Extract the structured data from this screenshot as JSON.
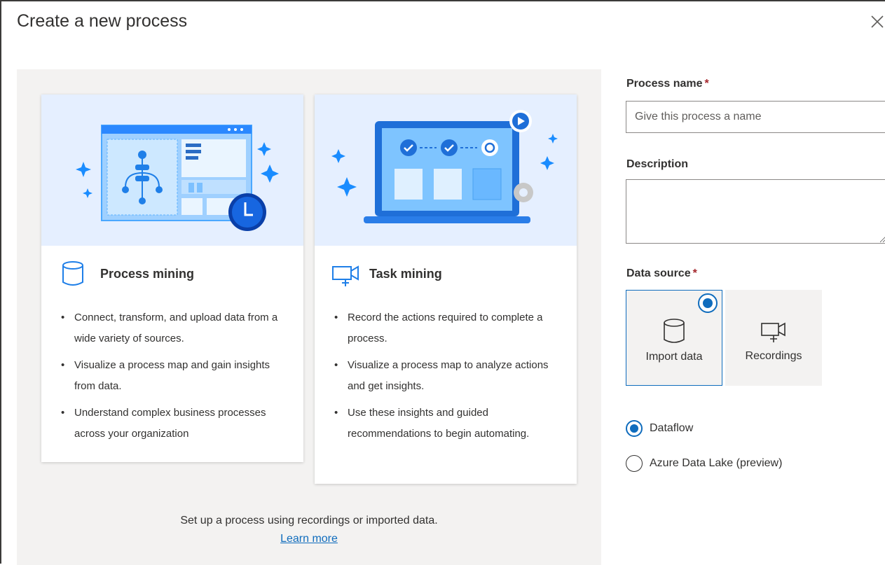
{
  "dialog": {
    "title": "Create a new process",
    "close_icon": "close-icon"
  },
  "cards": {
    "process_mining": {
      "title": "Process mining",
      "icon": "database-icon",
      "bullets": [
        "Connect, transform, and upload data from a wide variety of sources.",
        "Visualize a process map and gain insights from data.",
        "Understand complex business processes across your organization"
      ]
    },
    "task_mining": {
      "title": "Task mining",
      "icon": "video-record-icon",
      "bullets": [
        "Record the actions required to complete a process.",
        "Visualize a process map to analyze actions and get insights.",
        "Use these insights and guided recommendations to begin automating."
      ]
    }
  },
  "footer": {
    "setup_text": "Set up a process using recordings or imported data.",
    "learn_more": "Learn more"
  },
  "form": {
    "process_name_label": "Process name",
    "required_marker": "*",
    "process_name_placeholder": "Give this process a name",
    "process_name_value": "",
    "description_label": "Description",
    "description_value": "",
    "data_source_label": "Data source",
    "data_source_options": [
      {
        "label": "Import data",
        "icon": "database-icon",
        "selected": true
      },
      {
        "label": "Recordings",
        "icon": "video-record-icon",
        "selected": false
      }
    ],
    "import_options": [
      {
        "label": "Dataflow",
        "checked": true
      },
      {
        "label": "Azure Data Lake (preview)",
        "checked": false
      }
    ]
  },
  "colors": {
    "accent": "#0f6cbd",
    "panel_bg": "#f3f2f1",
    "hero_bg": "#e5efff",
    "required": "#a4262c"
  }
}
